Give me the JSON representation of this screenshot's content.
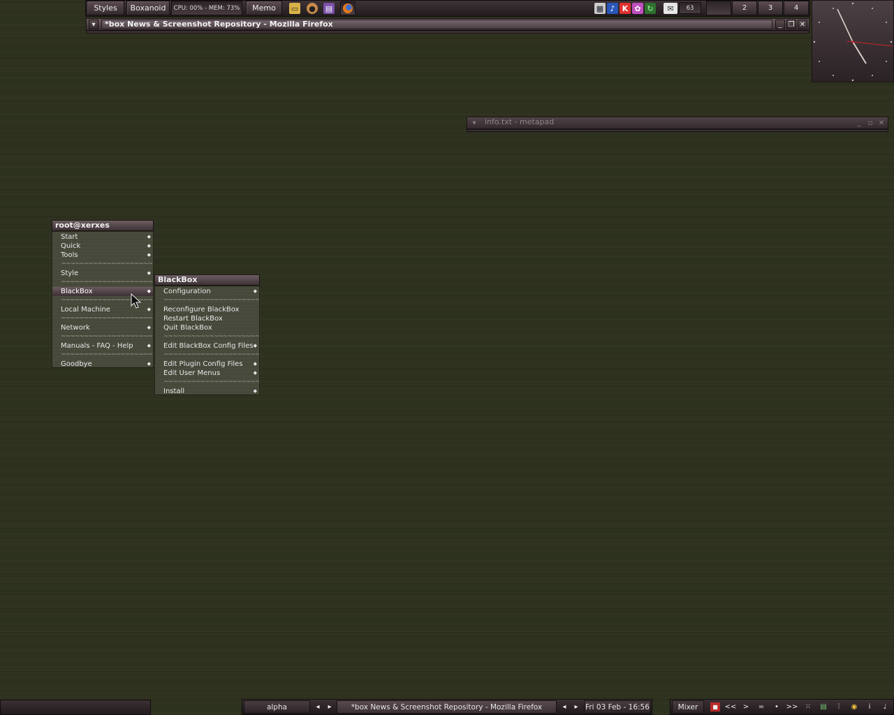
{
  "toolbar": {
    "styles_label": "Styles",
    "boxanoid_label": "Boxanoid",
    "cpu_mem": "CPU: 00% - MEM: 73%",
    "memo_label": "Memo",
    "launchers": [
      "folder-icon",
      "paint-icon",
      "book-icon",
      "firefox-icon"
    ],
    "tray_icons": [
      "network-icon",
      "audio-icon",
      "antivirus-icon",
      "messenger-icon",
      "update-icon"
    ],
    "mail_icon": "mail-icon",
    "mail_count": "63",
    "workspaces": [
      "",
      "2",
      "3",
      "4"
    ]
  },
  "firefox_window": {
    "title": "*box News & Screenshot Repository - Mozilla Firefox"
  },
  "metapad_window": {
    "title": "info.txt - metapad"
  },
  "root_menu": {
    "title": "root@xerxes",
    "items": [
      {
        "label": "Start",
        "submenu": true
      },
      {
        "label": "Quick",
        "submenu": true
      },
      {
        "label": "Tools",
        "submenu": true
      },
      {
        "label": "~~~~~~~~~~~~~~~~~~~~~~",
        "separator": true
      },
      {
        "label": "Style",
        "submenu": true
      },
      {
        "label": "~~~~~~~~~~~~~~~~~~~~~~",
        "separator": true
      },
      {
        "label": "BlackBox",
        "submenu": true,
        "active": true
      },
      {
        "label": "~~~~~~~~~~~~~~~~~~~~~~",
        "separator": true
      },
      {
        "label": "Local Machine",
        "submenu": true
      },
      {
        "label": "~~~~~~~~~~~~~~~~~~~~~~",
        "separator": true
      },
      {
        "label": "Network",
        "submenu": true
      },
      {
        "label": "~~~~~~~~~~~~~~~~~~~~~~",
        "separator": true
      },
      {
        "label": "Manuals - FAQ - Help",
        "submenu": true
      },
      {
        "label": "~~~~~~~~~~~~~~~~~~~~~~",
        "separator": true
      },
      {
        "label": "Goodbye",
        "submenu": true
      }
    ]
  },
  "blackbox_menu": {
    "title": "BlackBox",
    "items": [
      {
        "label": "Configuration",
        "submenu": true
      },
      {
        "label": "~~~~~~~~~~~~~~~~~~~~~~",
        "separator": true
      },
      {
        "label": "Reconfigure BlackBox",
        "submenu": false
      },
      {
        "label": "Restart BlackBox",
        "submenu": false
      },
      {
        "label": "Quit BlackBox",
        "submenu": false
      },
      {
        "label": "~~~~~~~~~~~~~~~~~~~~~~",
        "separator": true
      },
      {
        "label": "Edit BlackBox Config Files",
        "submenu": true
      },
      {
        "label": "~~~~~~~~~~~~~~~~~~~~~~",
        "separator": true
      },
      {
        "label": "Edit Plugin Config Files",
        "submenu": true
      },
      {
        "label": "Edit User Menus",
        "submenu": true
      },
      {
        "label": "~~~~~~~~~~~~~~~~~~~~~~",
        "separator": true
      },
      {
        "label": "Install",
        "submenu": true
      }
    ]
  },
  "taskbar": {
    "workspace_name": "alpha",
    "active_task": "*box News & Screenshot Repository - Mozilla Firefox",
    "datetime": "Fri 03 Feb - 16:56",
    "mixer_label": "Mixer",
    "media_buttons": [
      "<<",
      ">",
      "=",
      "•",
      ">>"
    ]
  },
  "colors": {
    "desktop": "#2f331f",
    "menu_bg": "#4b4e3e",
    "frame": "#5c4c50",
    "clock_second_hand": "#c8242a"
  }
}
